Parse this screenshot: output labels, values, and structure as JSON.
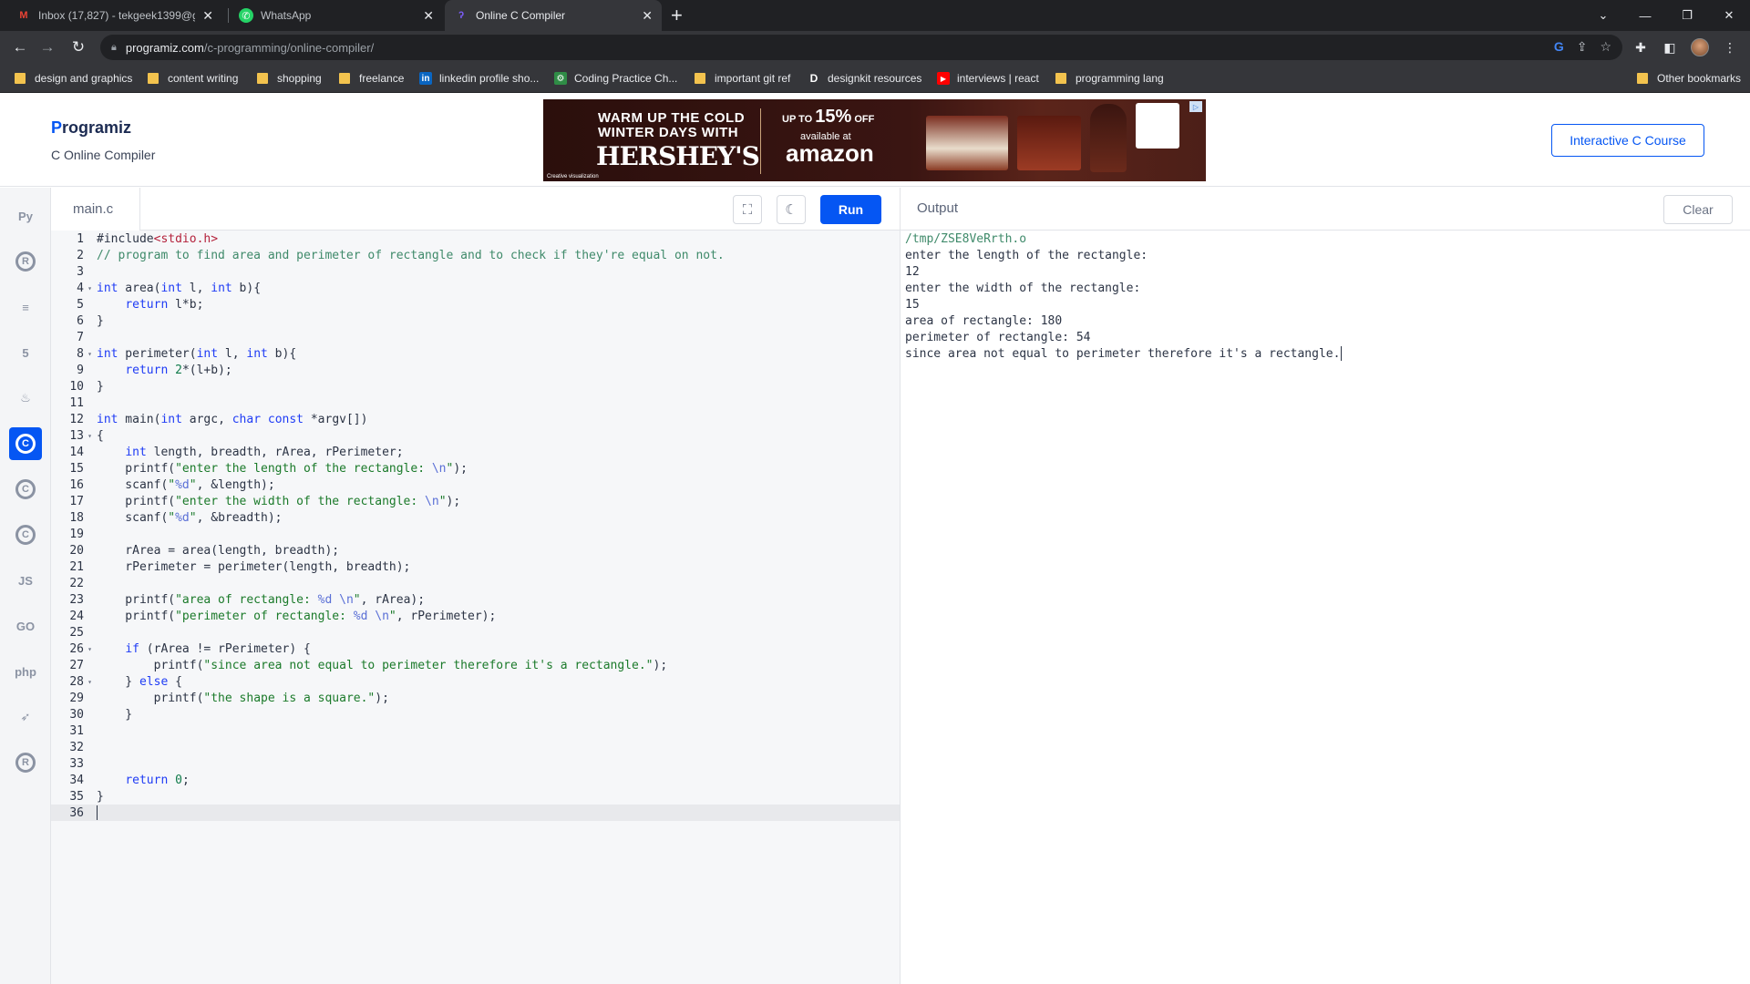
{
  "browser": {
    "tabs": [
      {
        "title": "Inbox (17,827) - tekgeek1399@gr",
        "icon": "gmail-icon"
      },
      {
        "title": "WhatsApp",
        "icon": "whatsapp-icon"
      },
      {
        "title": "Online C Compiler",
        "icon": "programiz-icon"
      }
    ],
    "url_host": "programiz.com",
    "url_path": "/c-programming/online-compiler/",
    "bookmarks": [
      {
        "label": "design and graphics",
        "type": "folder"
      },
      {
        "label": "content writing",
        "type": "folder"
      },
      {
        "label": "shopping",
        "type": "folder"
      },
      {
        "label": "freelance",
        "type": "folder"
      },
      {
        "label": "linkedin profile sho...",
        "type": "linkedin"
      },
      {
        "label": "Coding Practice Ch...",
        "type": "site"
      },
      {
        "label": "important git ref",
        "type": "folder"
      },
      {
        "label": "designkit resources",
        "type": "d"
      },
      {
        "label": "interviews | react",
        "type": "youtube"
      },
      {
        "label": "programming lang",
        "type": "folder"
      }
    ],
    "other_bookmarks": "Other bookmarks"
  },
  "header": {
    "logo_first": "P",
    "logo_rest": "rogramiz",
    "subtitle": "C Online Compiler",
    "course_button": "Interactive C Course"
  },
  "ad": {
    "line1": "WARM UP THE COLD",
    "line2": "WINTER DAYS WITH",
    "brand": "HERSHEY'S",
    "offer_prefix": "UP TO",
    "offer_value": "15%",
    "offer_suffix": "OFF",
    "available": "available at",
    "retailer": "amazon",
    "footer": "Creative visualization"
  },
  "languages": [
    {
      "name": "python-icon",
      "glyph": "Py"
    },
    {
      "name": "r-icon",
      "glyph": "R"
    },
    {
      "name": "sql-icon",
      "glyph": "≡"
    },
    {
      "name": "html-icon",
      "glyph": "5"
    },
    {
      "name": "java-icon",
      "glyph": "♨"
    },
    {
      "name": "c-icon",
      "glyph": "C",
      "active": true
    },
    {
      "name": "cpp-icon",
      "glyph": "C"
    },
    {
      "name": "csharp-icon",
      "glyph": "C"
    },
    {
      "name": "js-icon",
      "glyph": "JS"
    },
    {
      "name": "go-icon",
      "glyph": "GO"
    },
    {
      "name": "php-icon",
      "glyph": "php"
    },
    {
      "name": "swift-icon",
      "glyph": "➶"
    },
    {
      "name": "rust-icon",
      "glyph": "R"
    }
  ],
  "editor": {
    "filename": "main.c",
    "run_label": "Run",
    "lines": [
      "#include<stdio.h>",
      "// program to find area and perimeter of rectangle and to check if they're equal on not.",
      "",
      "int area(int l, int b){",
      "    return l*b;",
      "}",
      "",
      "int perimeter(int l, int b){",
      "    return 2*(l+b);",
      "}",
      "",
      "int main(int argc, char const *argv[])",
      "{",
      "    int length, breadth, rArea, rPerimeter;",
      "    printf(\"enter the length of the rectangle: \\n\");",
      "    scanf(\"%d\", &length);",
      "    printf(\"enter the width of the rectangle: \\n\");",
      "    scanf(\"%d\", &breadth);",
      "",
      "    rArea = area(length, breadth);",
      "    rPerimeter = perimeter(length, breadth);",
      "",
      "    printf(\"area of rectangle: %d \\n\", rArea);",
      "    printf(\"perimeter of rectangle: %d \\n\", rPerimeter);",
      "",
      "    if (rArea != rPerimeter) {",
      "        printf(\"since area not equal to perimeter therefore it's a rectangle.\");",
      "    } else {",
      "        printf(\"the shape is a square.\");",
      "    }",
      "",
      "",
      "",
      "    return 0;",
      "}",
      ""
    ],
    "fold_lines": [
      4,
      8,
      13,
      26,
      28
    ],
    "current_line": 36
  },
  "output": {
    "title": "Output",
    "clear_label": "Clear",
    "lines": [
      "/tmp/ZSE8VeRrth.o",
      "enter the length of the rectangle:",
      "12",
      "enter the width of the rectangle:",
      "15",
      "area of rectangle: 180",
      "perimeter of rectangle: 54",
      "since area not equal to perimeter therefore it's a rectangle."
    ]
  },
  "colors": {
    "accent": "#0556f3",
    "keyword": "#1f3cf5",
    "string": "#1b7a2a",
    "comment": "#3f8a6a",
    "include": "#b4223c"
  }
}
